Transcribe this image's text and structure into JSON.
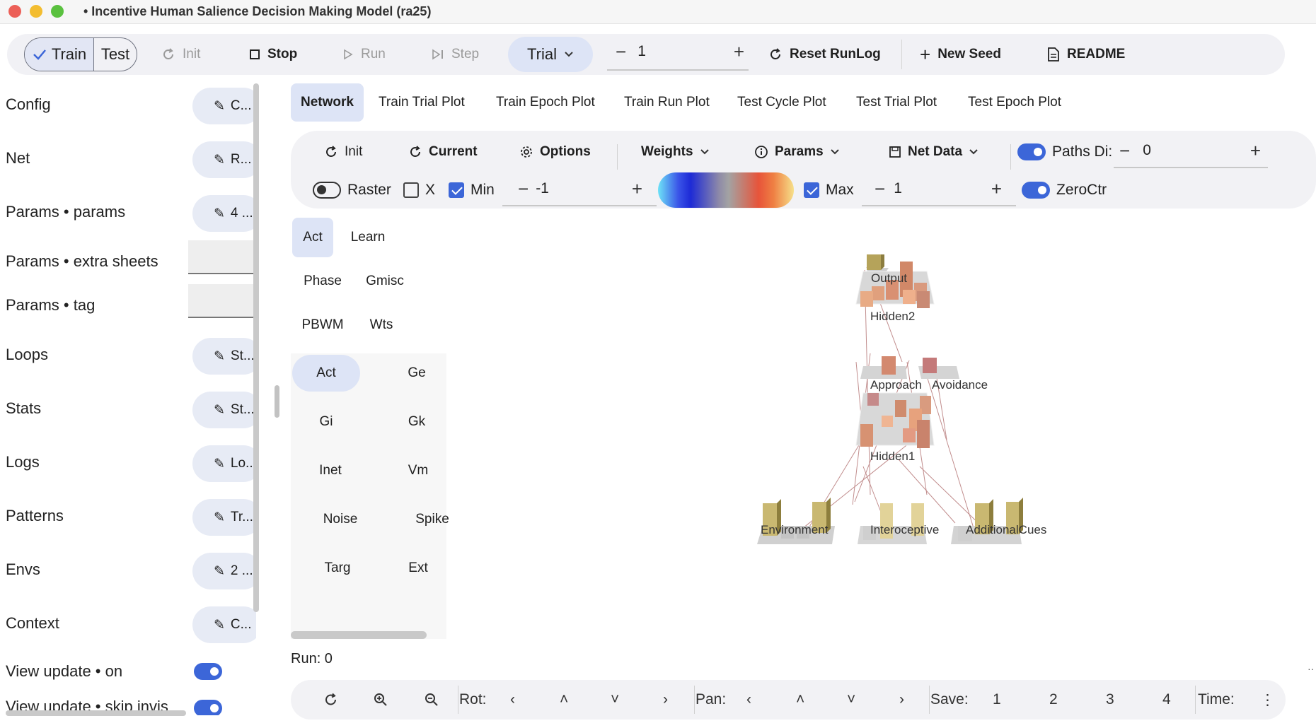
{
  "window": {
    "title": "• Incentive Human Salience Decision Making Model (ra25)"
  },
  "toolbar": {
    "train_label": "Train",
    "test_label": "Test",
    "init_label": "Init",
    "stop_label": "Stop",
    "run_label": "Run",
    "step_label": "Step",
    "trial_label": "Trial",
    "step_count": "1",
    "reset_runlog_label": "Reset RunLog",
    "new_seed_label": "New Seed",
    "readme_label": "README"
  },
  "sidebar": {
    "items": [
      {
        "label": "Config",
        "button": "C..."
      },
      {
        "label": "Net",
        "button": "R..."
      },
      {
        "label": "Params • params",
        "button": "4 ..."
      },
      {
        "label": "Params • extra sheets",
        "field": ""
      },
      {
        "label": "Params • tag",
        "field": ""
      },
      {
        "label": "Loops",
        "button": "St..."
      },
      {
        "label": "Stats",
        "button": "St..."
      },
      {
        "label": "Logs",
        "button": "Lo..."
      },
      {
        "label": "Patterns",
        "button": "Tr..."
      },
      {
        "label": "Envs",
        "button": "2 ..."
      },
      {
        "label": "Context",
        "button": "C..."
      }
    ],
    "view_update_on": "View update • on",
    "view_update_skip": "View update • skip invis"
  },
  "tabs": [
    "Network",
    "Train Trial Plot",
    "Train Epoch Plot",
    "Train Run Plot",
    "Test Cycle Plot",
    "Test Trial Plot",
    "Test Epoch Plot"
  ],
  "netview": {
    "init_label": "Init",
    "current_label": "Current",
    "options_label": "Options",
    "weights_label": "Weights",
    "params_label": "Params",
    "netdata_label": "Net Data",
    "paths_label": "Paths Di:",
    "paths_value": "0",
    "raster_label": "Raster",
    "x_label": "X",
    "min_label": "Min",
    "min_value": "-1",
    "max_label": "Max",
    "max_value": "1",
    "zeroctr_label": "ZeroCtr",
    "subtabs_row1": [
      "Act",
      "Learn"
    ],
    "subtabs_row2": [
      "Phase",
      "Gmisc"
    ],
    "subtabs_row3": [
      "PBWM",
      "Wts"
    ],
    "vars": [
      "Act",
      "Ge",
      "Gi",
      "Gk",
      "Inet",
      "Vm",
      "Noise",
      "Spike",
      "Targ",
      "Ext"
    ],
    "layers": {
      "output": "Output",
      "hidden2": "Hidden2",
      "approach": "Approach",
      "avoidance": "Avoidance",
      "hidden1": "Hidden1",
      "environment": "Environment",
      "interoceptive": "Interoceptive",
      "additional_cues": "AdditionalCues"
    },
    "run_text": "Run:  0"
  },
  "bottombar": {
    "rot_label": "Rot:",
    "pan_label": "Pan:",
    "save_label": "Save:",
    "save_slots": [
      "1",
      "2",
      "3",
      "4"
    ],
    "time_label": "Time:"
  },
  "colors": {
    "accent": "#3c66d8",
    "active_tab": "#dde4f6",
    "toolbar_bg": "#f1f1f5"
  }
}
